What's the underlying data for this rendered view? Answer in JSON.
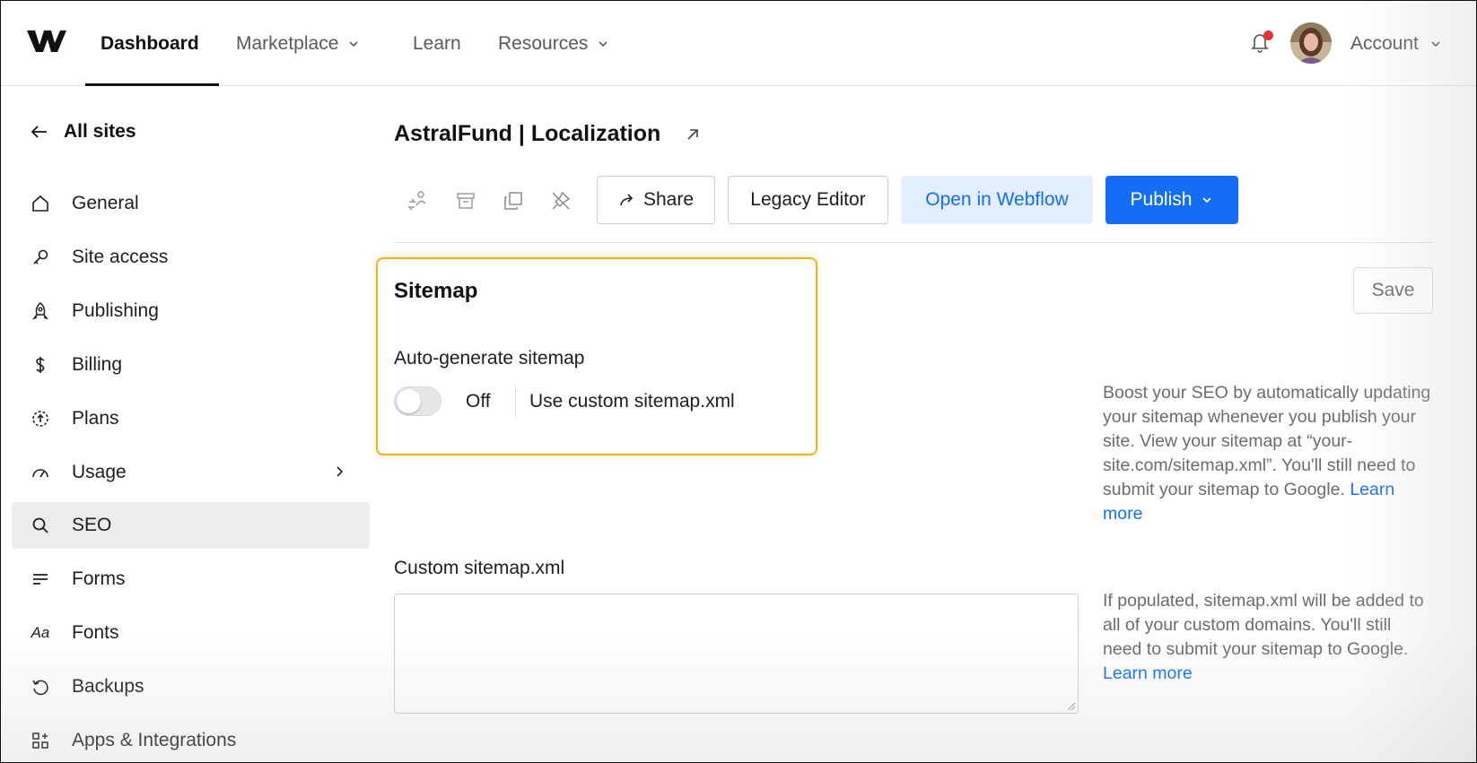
{
  "topnav": {
    "items": [
      {
        "label": "Dashboard",
        "active": true
      },
      {
        "label": "Marketplace"
      },
      {
        "label": "Learn"
      },
      {
        "label": "Resources"
      }
    ],
    "account_label": "Account",
    "notification_dot_color": "#e5342b"
  },
  "sidebar": {
    "back_label": "All sites",
    "items": [
      {
        "label": "General",
        "icon": "home-icon"
      },
      {
        "label": "Site access",
        "icon": "key-icon"
      },
      {
        "label": "Publishing",
        "icon": "rocket-icon"
      },
      {
        "label": "Billing",
        "icon": "dollar-icon"
      },
      {
        "label": "Plans",
        "icon": "upgrade-icon"
      },
      {
        "label": "Usage",
        "icon": "gauge-icon"
      },
      {
        "label": "SEO",
        "icon": "search-icon",
        "active": true
      },
      {
        "label": "Forms",
        "icon": "forms-icon"
      },
      {
        "label": "Fonts",
        "icon": "fonts-icon",
        "glyph": "Aa"
      },
      {
        "label": "Backups",
        "icon": "restore-icon"
      },
      {
        "label": "Apps & Integrations",
        "icon": "apps-icon"
      }
    ]
  },
  "main": {
    "site_title": "AstralFund | Localization",
    "toolbar": {
      "share_label": "Share",
      "legacy_editor_label": "Legacy Editor",
      "open_in_webflow_label": "Open in Webflow",
      "publish_label": "Publish"
    },
    "sitemap": {
      "title": "Sitemap",
      "save_label": "Save",
      "auto_generate_label": "Auto-generate sitemap",
      "toggle_state": "Off",
      "custom_link_label": "Use custom sitemap.xml",
      "help_text": "Boost your SEO by automatically updating your sitemap whenever you publish your site. View your sitemap at “your-site.com/sitemap.xml”. You'll still need to submit your sitemap to Google.",
      "learn_more": "Learn more"
    },
    "custom_sitemap": {
      "label": "Custom sitemap.xml",
      "value": "",
      "help_text": "If populated, sitemap.xml will be added to all of your custom domains. You'll still need to submit your sitemap to Google.",
      "learn_more": "Learn more"
    }
  },
  "colors": {
    "accent": "#146ef5",
    "highlight_border": "#f2b21f",
    "active_row": "#ececec"
  }
}
